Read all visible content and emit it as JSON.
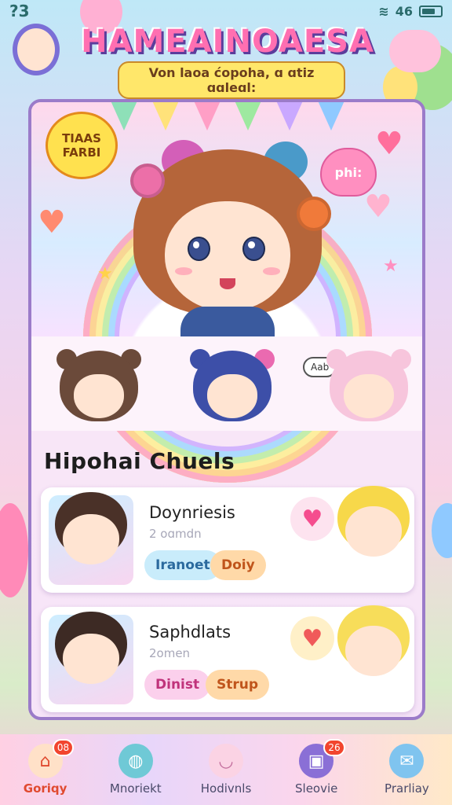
{
  "status": {
    "left_glyph": "?3",
    "signal": "46"
  },
  "header": {
    "title": "HAMEAINOAESA",
    "subtitle": "Von laoa ćopoha, ɑ ɑtiz ɑɑleɑl:"
  },
  "hero": {
    "bubble_text": "TIAAS FARBI",
    "heart_text": "phi:",
    "speech_text": "Aab"
  },
  "section_title": "Hipohai Chuels",
  "cards": [
    {
      "name": "Doynriesis",
      "sub": "2 oɑmdn",
      "tag1": "Iranoet",
      "tag2": "Doiy",
      "heart": "♥"
    },
    {
      "name": "Saphdlats",
      "sub": "2omen",
      "tag1": "Dinist",
      "tag2": "Strup",
      "heart": "♥"
    }
  ],
  "nav": [
    {
      "label": "Goriqy",
      "icon": "home-icon",
      "badge": "08"
    },
    {
      "label": "Mnoriekt",
      "icon": "planet-icon",
      "badge": ""
    },
    {
      "label": "Hodivnls",
      "icon": "bowl-icon",
      "badge": ""
    },
    {
      "label": "Sleovie",
      "icon": "bag-icon",
      "badge": "26"
    },
    {
      "label": "Prarliay",
      "icon": "chat-bird-icon",
      "badge": ""
    }
  ],
  "colors": {
    "accent": "#ff6fb1",
    "panel_border": "#9b7bc9",
    "badge": "#f2452e"
  }
}
